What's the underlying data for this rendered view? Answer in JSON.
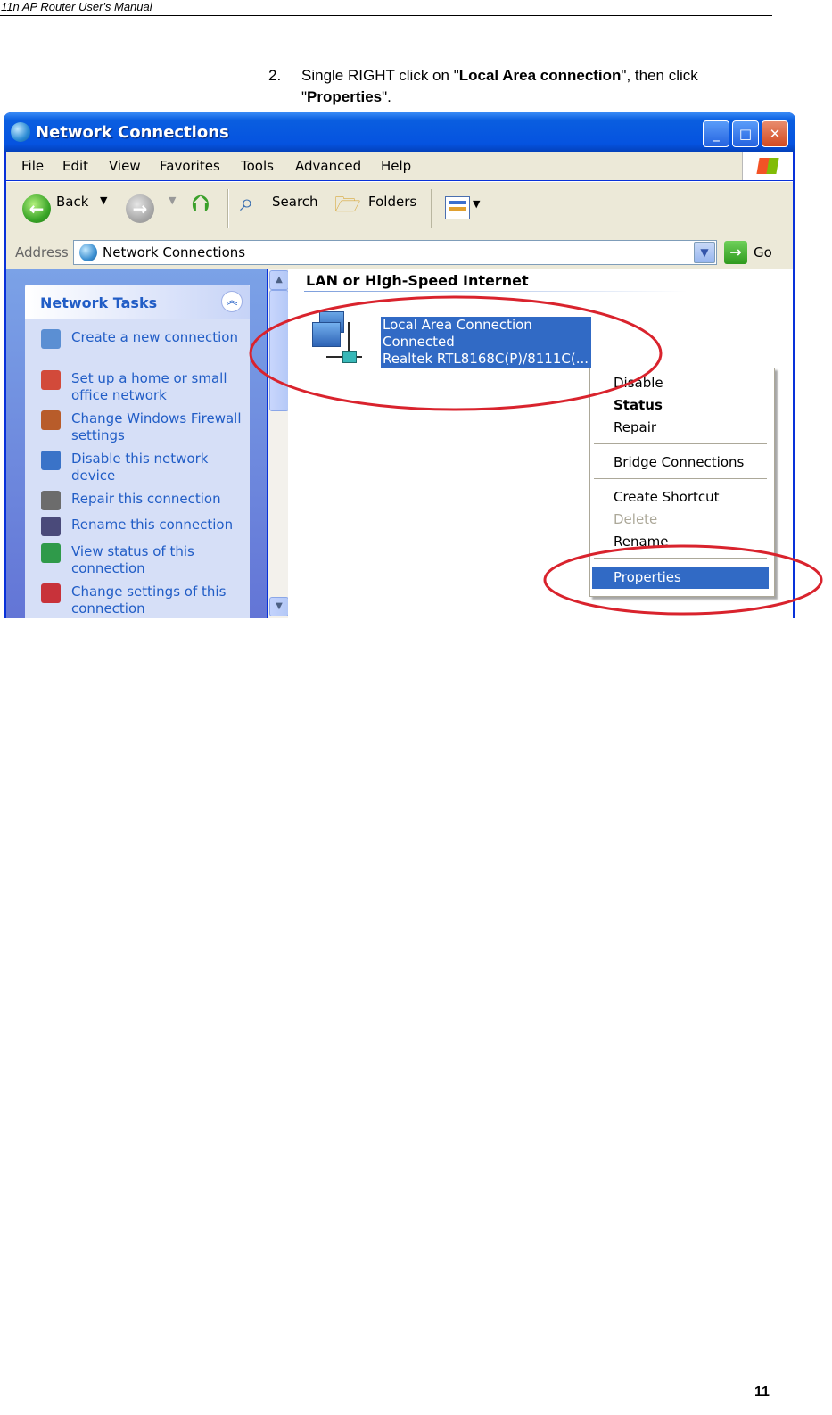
{
  "doc": {
    "header": "11n AP Router User's Manual",
    "step_number": "2.",
    "step_text_parts": [
      "Single RIGHT click on \"",
      "Local Area connection",
      "\", then click \"",
      "Properties",
      "\"."
    ],
    "page_number": "11"
  },
  "window": {
    "title": "Network Connections",
    "controls": {
      "minimize": "_",
      "maximize": "□",
      "close": "✕"
    },
    "menu": [
      "File",
      "Edit",
      "View",
      "Favorites",
      "Tools",
      "Advanced",
      "Help"
    ],
    "toolbar": {
      "back": "Back",
      "search": "Search",
      "folders": "Folders"
    },
    "address": {
      "label": "Address",
      "value": "Network Connections",
      "go": "Go"
    }
  },
  "left_pane": {
    "title": "Network Tasks",
    "tasks": [
      "Create a new connection",
      "Set up a home or small office network",
      "Change Windows Firewall settings",
      "Disable this network device",
      "Repair this connection",
      "Rename this connection",
      "View status of this connection",
      "Change settings of this connection"
    ],
    "icons": [
      "new-connection-icon",
      "home-network-icon",
      "firewall-icon",
      "disable-device-icon",
      "repair-icon",
      "rename-icon",
      "view-status-icon",
      "change-settings-icon"
    ],
    "icon_colors": [
      "#5b8fd3",
      "#d24a3a",
      "#b85c2a",
      "#3a73c8",
      "#6c6c6c",
      "#4a4a7a",
      "#2f9a4a",
      "#c8323a"
    ]
  },
  "content": {
    "group_title": "LAN or High-Speed Internet",
    "connection": {
      "name": "Local Area Connection",
      "status": "Connected",
      "device": "Realtek RTL8168C(P)/8111C(..."
    }
  },
  "context_menu": {
    "items": [
      {
        "label": "Disable",
        "style": "normal"
      },
      {
        "label": "Status",
        "style": "bold"
      },
      {
        "label": "Repair",
        "style": "normal"
      },
      {
        "label": "Bridge Connections",
        "style": "normal"
      },
      {
        "label": "Create Shortcut",
        "style": "normal"
      },
      {
        "label": "Delete",
        "style": "disabled"
      },
      {
        "label": "Rename",
        "style": "normal"
      },
      {
        "label": "Properties",
        "style": "highlighted"
      }
    ]
  },
  "colors": {
    "annotation": "#d9232d",
    "selection": "#316ac5",
    "xp_blue": "#0553e0"
  }
}
